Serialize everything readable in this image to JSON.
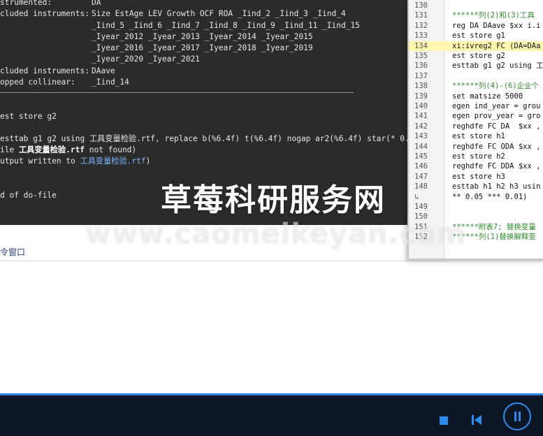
{
  "console": {
    "lines": [
      {
        "label": "strumented:",
        "value": "DA"
      },
      {
        "label": "cluded instruments:",
        "value": "Size EstAge LEV Growth OCF ROA _Iind_2 _Iind_3 _Iind_4"
      },
      {
        "label": "",
        "value": "_Iind_5 _Iind_6 _Iind_7 _Iind_8 _Iind_9 _Iind_11 _Iind_15"
      },
      {
        "label": "",
        "value": "_Iyear_2012 _Iyear_2013 _Iyear_2014 _Iyear_2015"
      },
      {
        "label": "",
        "value": "_Iyear_2016 _Iyear_2017 _Iyear_2018 _Iyear_2019"
      },
      {
        "label": "",
        "value": "_Iyear_2020 _Iyear_2021"
      },
      {
        "label": "cluded instruments:",
        "value": "DAave"
      },
      {
        "label": "opped collinear:",
        "value": "_Iind_14"
      }
    ],
    "cmd1": "est store g2",
    "cmd2": "esttab g1 g2 using 工具变量检验.rtf, replace b(%6.4f) t(%6.4f) nogap ar2(%6.4f) star(* 0.",
    "file_prefix": "ile",
    "file_name": "工具变量检验.rtf",
    "file_suffix": "not found)",
    "output_prefix": "utput written to",
    "output_link": "工具变量检验.rtf",
    "output_suffix": ")",
    "end": "d of do-file"
  },
  "command_window": {
    "label": "令窗口"
  },
  "editor": {
    "lines": [
      {
        "num": "130",
        "code": "",
        "type": "plain"
      },
      {
        "num": "131",
        "code": "******列(2)和(3)工具",
        "type": "comment"
      },
      {
        "num": "132",
        "code": "reg DA DAave $xx i.i",
        "type": "plain"
      },
      {
        "num": "133",
        "code": "est store g1",
        "type": "plain"
      },
      {
        "num": "134",
        "code": "xi:ivreg2 FC (DA=DAa",
        "type": "hl"
      },
      {
        "num": "135",
        "code": "est store g2",
        "type": "plain"
      },
      {
        "num": "136",
        "code": "esttab g1 g2 using 工",
        "type": "plain"
      },
      {
        "num": "137",
        "code": "",
        "type": "plain"
      },
      {
        "num": "138",
        "code": "******列(4)-(6)企业个",
        "type": "comment"
      },
      {
        "num": "139",
        "code": "set matsize 5000",
        "type": "plain"
      },
      {
        "num": "140",
        "code": "egen ind_year = grou",
        "type": "plain"
      },
      {
        "num": "141",
        "code": "egen prov_year = gro",
        "type": "plain"
      },
      {
        "num": "142",
        "code": "reghdfe FC DA  $xx ,",
        "type": "plain"
      },
      {
        "num": "143",
        "code": "est store h1",
        "type": "plain"
      },
      {
        "num": "144",
        "code": "reghdfe FC ODA $xx ,",
        "type": "plain"
      },
      {
        "num": "145",
        "code": "est store h2",
        "type": "plain"
      },
      {
        "num": "146",
        "code": "reghdfe FC DDA $xx ,",
        "type": "plain"
      },
      {
        "num": "147",
        "code": "est store h3",
        "type": "plain"
      },
      {
        "num": "148",
        "code": "esttab h1 h2 h3 usin",
        "type": "plain"
      },
      {
        "num": "↳",
        "code": "** 0.05 *** 0.01)",
        "type": "plain"
      },
      {
        "num": "149",
        "code": "",
        "type": "plain"
      },
      {
        "num": "150",
        "code": "",
        "type": "plain"
      },
      {
        "num": "151",
        "code": "******附表7; 替换变量",
        "type": "comment"
      },
      {
        "num": "152",
        "code": "******列(1)替换解释变",
        "type": "comment"
      }
    ]
  },
  "watermark": {
    "cn": "草莓科研服务网",
    "en": "www.caomeikeyan.com"
  },
  "player": {
    "accent_color": "#2d8cf0",
    "stop_icon": "stop-icon",
    "prev_icon": "skip-back-icon",
    "pause_icon": "pause-icon"
  }
}
